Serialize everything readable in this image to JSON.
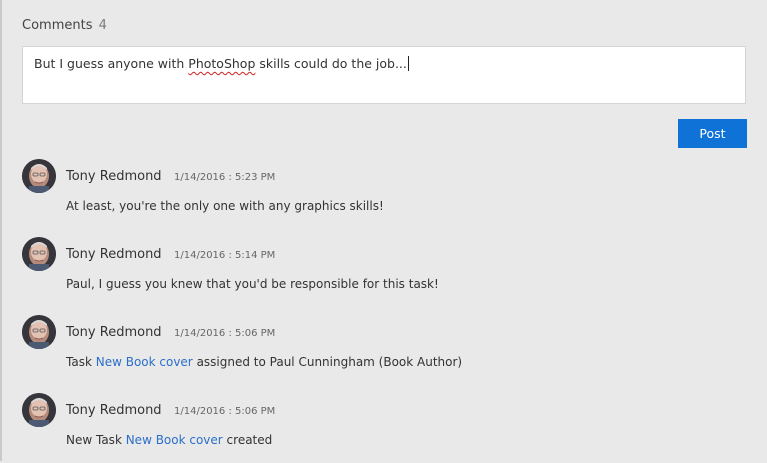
{
  "comments": {
    "header_label": "Comments",
    "count": "4",
    "input_value_before": "But I guess anyone with ",
    "input_value_misspelled": "PhotoShop",
    "input_value_after": " skills could do the job...",
    "post_label": "Post",
    "items": [
      {
        "author": "Tony Redmond",
        "timestamp": "1/14/2016 : 5:23 PM",
        "text": "At least, you're the only one with any graphics skills!"
      },
      {
        "author": "Tony Redmond",
        "timestamp": "1/14/2016 : 5:14 PM",
        "text": "Paul, I guess you knew that you'd be responsible for this task!"
      },
      {
        "author": "Tony Redmond",
        "timestamp": "1/14/2016 : 5:06 PM",
        "text_before": "Task ",
        "link": "New Book cover",
        "text_after": " assigned to Paul Cunningham (Book Author)"
      },
      {
        "author": "Tony Redmond",
        "timestamp": "1/14/2016 : 5:06 PM",
        "text_before": "New Task ",
        "link": "New Book cover",
        "text_after": " created"
      }
    ]
  },
  "colors": {
    "background": "#e9e9e9",
    "accent": "#0e72d6",
    "link": "#2a6fc9"
  }
}
